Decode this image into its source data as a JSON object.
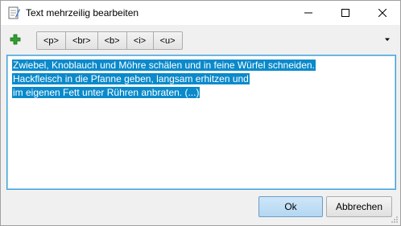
{
  "window": {
    "title": "Text mehrzeilig bearbeiten",
    "controls": {
      "minimize": "minimize",
      "maximize": "maximize",
      "close": "close"
    }
  },
  "toolbar": {
    "add_icon": "plus-icon",
    "tags": [
      "<p>",
      "<br>",
      "<b>",
      "<i>",
      "<u>"
    ],
    "overflow_icon": "dropdown-arrow-icon"
  },
  "editor": {
    "lines": [
      "Zwiebel, Knoblauch und Möhre schälen und in feine Würfel schneiden.",
      "Hackfleisch in die Pfanne geben, langsam erhitzen und",
      "im eigenen Fett unter Rühren anbraten. (...)"
    ],
    "selection_color": "#0a8acb"
  },
  "buttons": {
    "ok": "Ok",
    "cancel": "Abbrechen"
  },
  "colors": {
    "accent": "#3c9dd7",
    "add_icon": "#2ea02e"
  }
}
